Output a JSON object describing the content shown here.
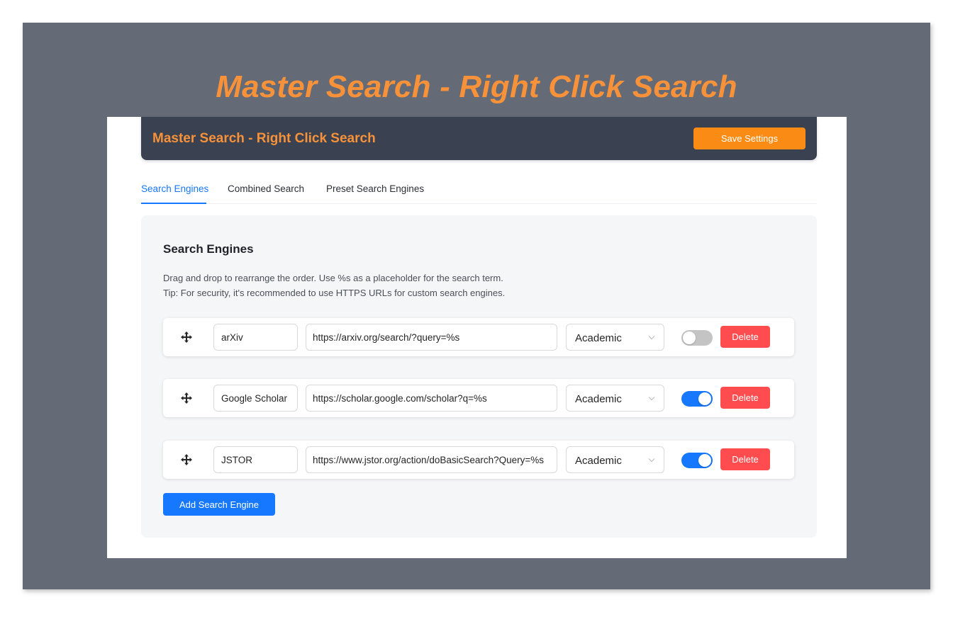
{
  "hero": {
    "title": "Master Search - Right Click Search"
  },
  "header": {
    "title": "Master Search - Right Click Search",
    "save_label": "Save Settings"
  },
  "tabs": [
    {
      "label": "Search Engines",
      "active": true
    },
    {
      "label": "Combined Search",
      "active": false
    },
    {
      "label": "Preset Search Engines",
      "active": false
    }
  ],
  "section": {
    "title": "Search Engines",
    "description_line1": "Drag and drop to rearrange the order. Use %s as a placeholder for the search term.",
    "description_line2": "Tip: For security, it's recommended to use HTTPS URLs for custom search engines."
  },
  "engines": [
    {
      "name": "arXiv",
      "url": "https://arxiv.org/search/?query=%s",
      "category": "Academic",
      "enabled": false,
      "delete_label": "Delete"
    },
    {
      "name": "Google Scholar",
      "url": "https://scholar.google.com/scholar?q=%s",
      "category": "Academic",
      "enabled": true,
      "delete_label": "Delete"
    },
    {
      "name": "JSTOR",
      "url": "https://www.jstor.org/action/doBasicSearch?Query=%s",
      "category": "Academic",
      "enabled": true,
      "delete_label": "Delete"
    }
  ],
  "add_label": "Add Search Engine",
  "colors": {
    "accent_orange": "#f7923a",
    "primary_blue": "#1677ff",
    "danger_red": "#ff4d4f",
    "header_dark": "#3a4150",
    "backdrop_gray": "#646a76"
  },
  "icons": {
    "drag": "move-arrows-icon",
    "select_arrow": "chevron-down-icon"
  }
}
